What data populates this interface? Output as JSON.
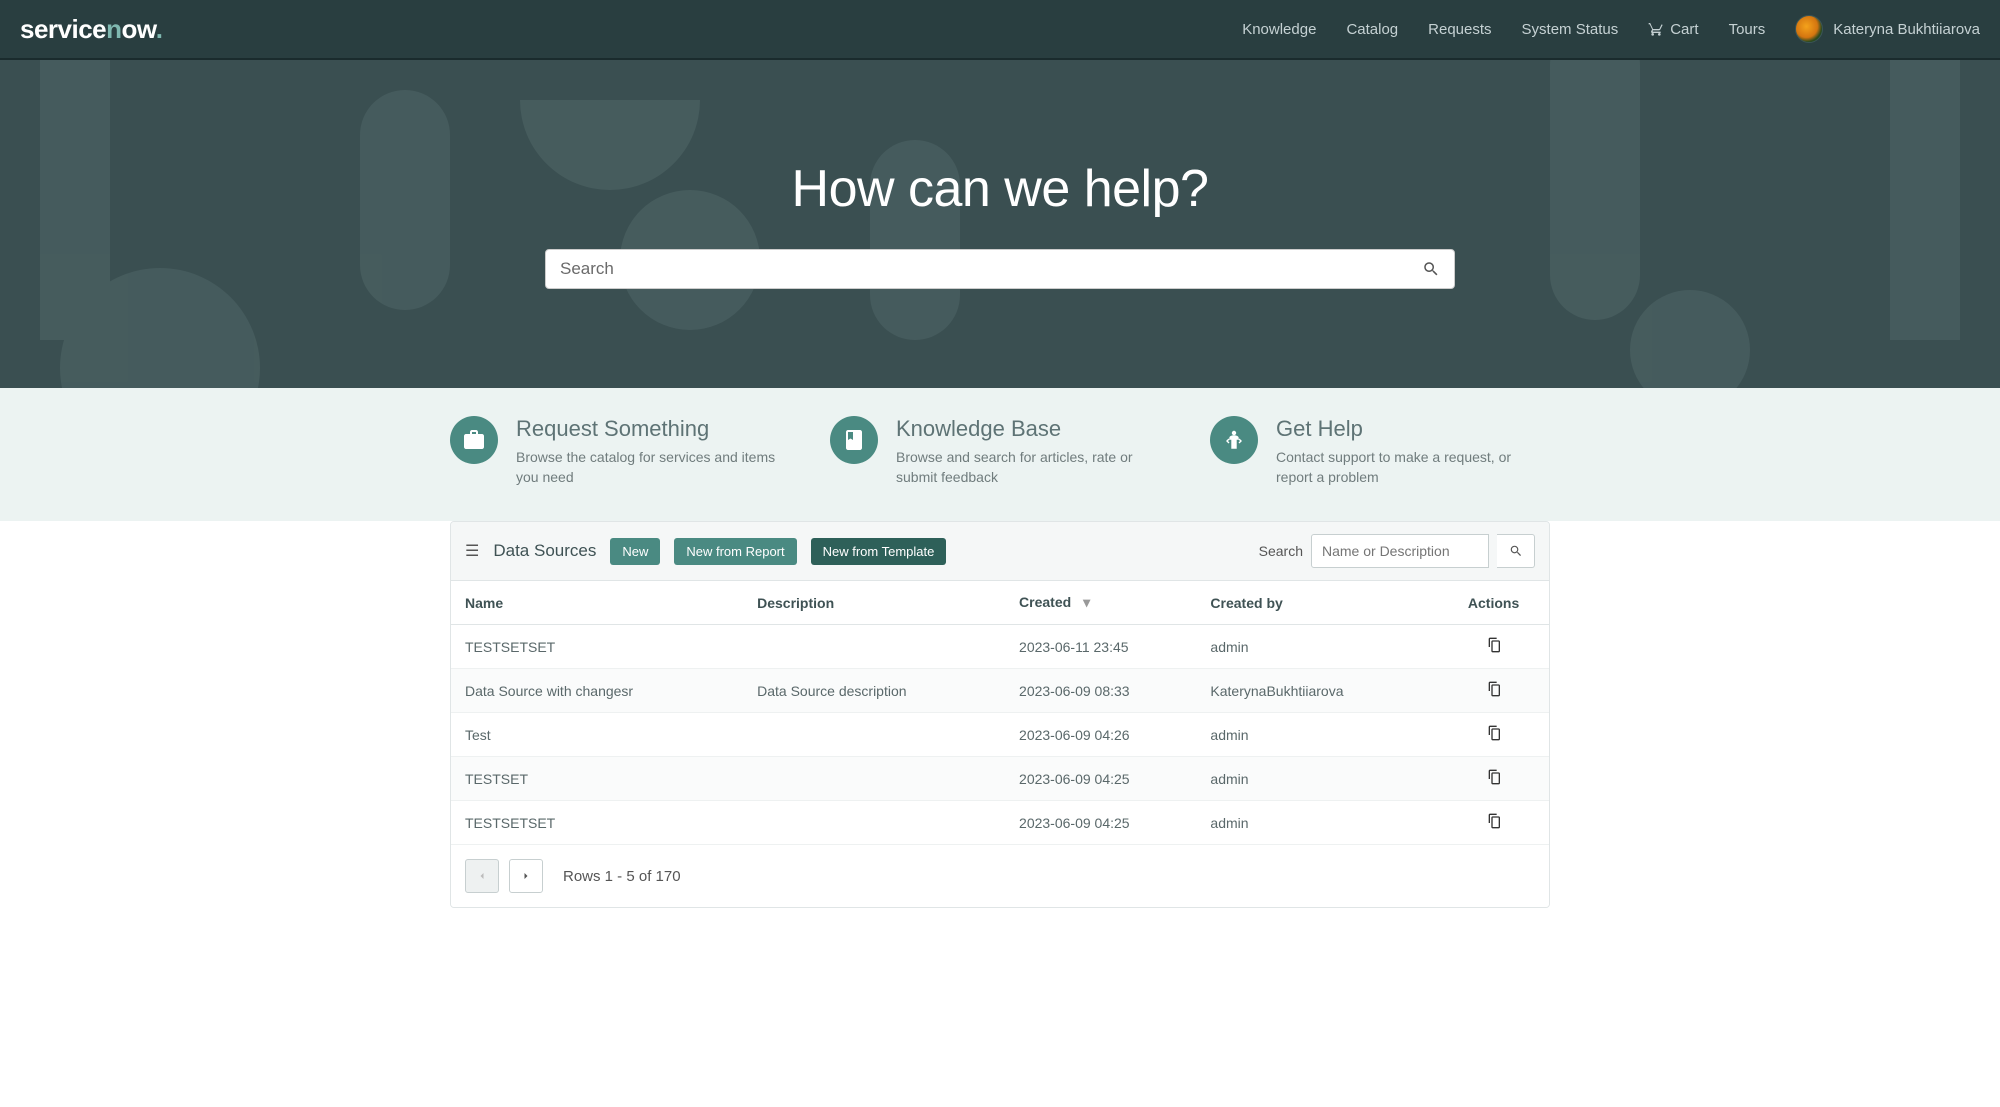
{
  "nav": {
    "logo_pre": "service",
    "logo_hl": "n",
    "logo_post": "ow",
    "links": [
      "Knowledge",
      "Catalog",
      "Requests",
      "System Status"
    ],
    "cart": "Cart",
    "tours": "Tours",
    "user": "Kateryna Bukhtiiarova"
  },
  "hero": {
    "title": "How can we help?",
    "search_placeholder": "Search"
  },
  "quicklinks": [
    {
      "title": "Request Something",
      "desc": "Browse the catalog for services and items you need",
      "icon": "briefcase"
    },
    {
      "title": "Knowledge Base",
      "desc": "Browse and search for articles, rate or submit feedback",
      "icon": "book"
    },
    {
      "title": "Get Help",
      "desc": "Contact support to make a request, or report a problem",
      "icon": "person"
    }
  ],
  "panel": {
    "title": "Data Sources",
    "buttons": {
      "new": "New",
      "from_report": "New from Report",
      "from_template": "New from Template"
    },
    "search_label": "Search",
    "search_placeholder": "Name or Description",
    "columns": {
      "name": "Name",
      "description": "Description",
      "created": "Created",
      "created_by": "Created by",
      "actions": "Actions"
    },
    "rows": [
      {
        "name": "TESTSETSET",
        "description": "",
        "created": "2023-06-11 23:45",
        "created_by": "admin"
      },
      {
        "name": "Data Source with changesr",
        "description": "Data Source description",
        "created": "2023-06-09 08:33",
        "created_by": "KaterynaBukhtiiarova"
      },
      {
        "name": "Test",
        "description": "",
        "created": "2023-06-09 04:26",
        "created_by": "admin"
      },
      {
        "name": "TESTSET",
        "description": "",
        "created": "2023-06-09 04:25",
        "created_by": "admin"
      },
      {
        "name": "TESTSETSET",
        "description": "",
        "created": "2023-06-09 04:25",
        "created_by": "admin"
      }
    ],
    "pager": "Rows 1 - 5 of 170"
  }
}
